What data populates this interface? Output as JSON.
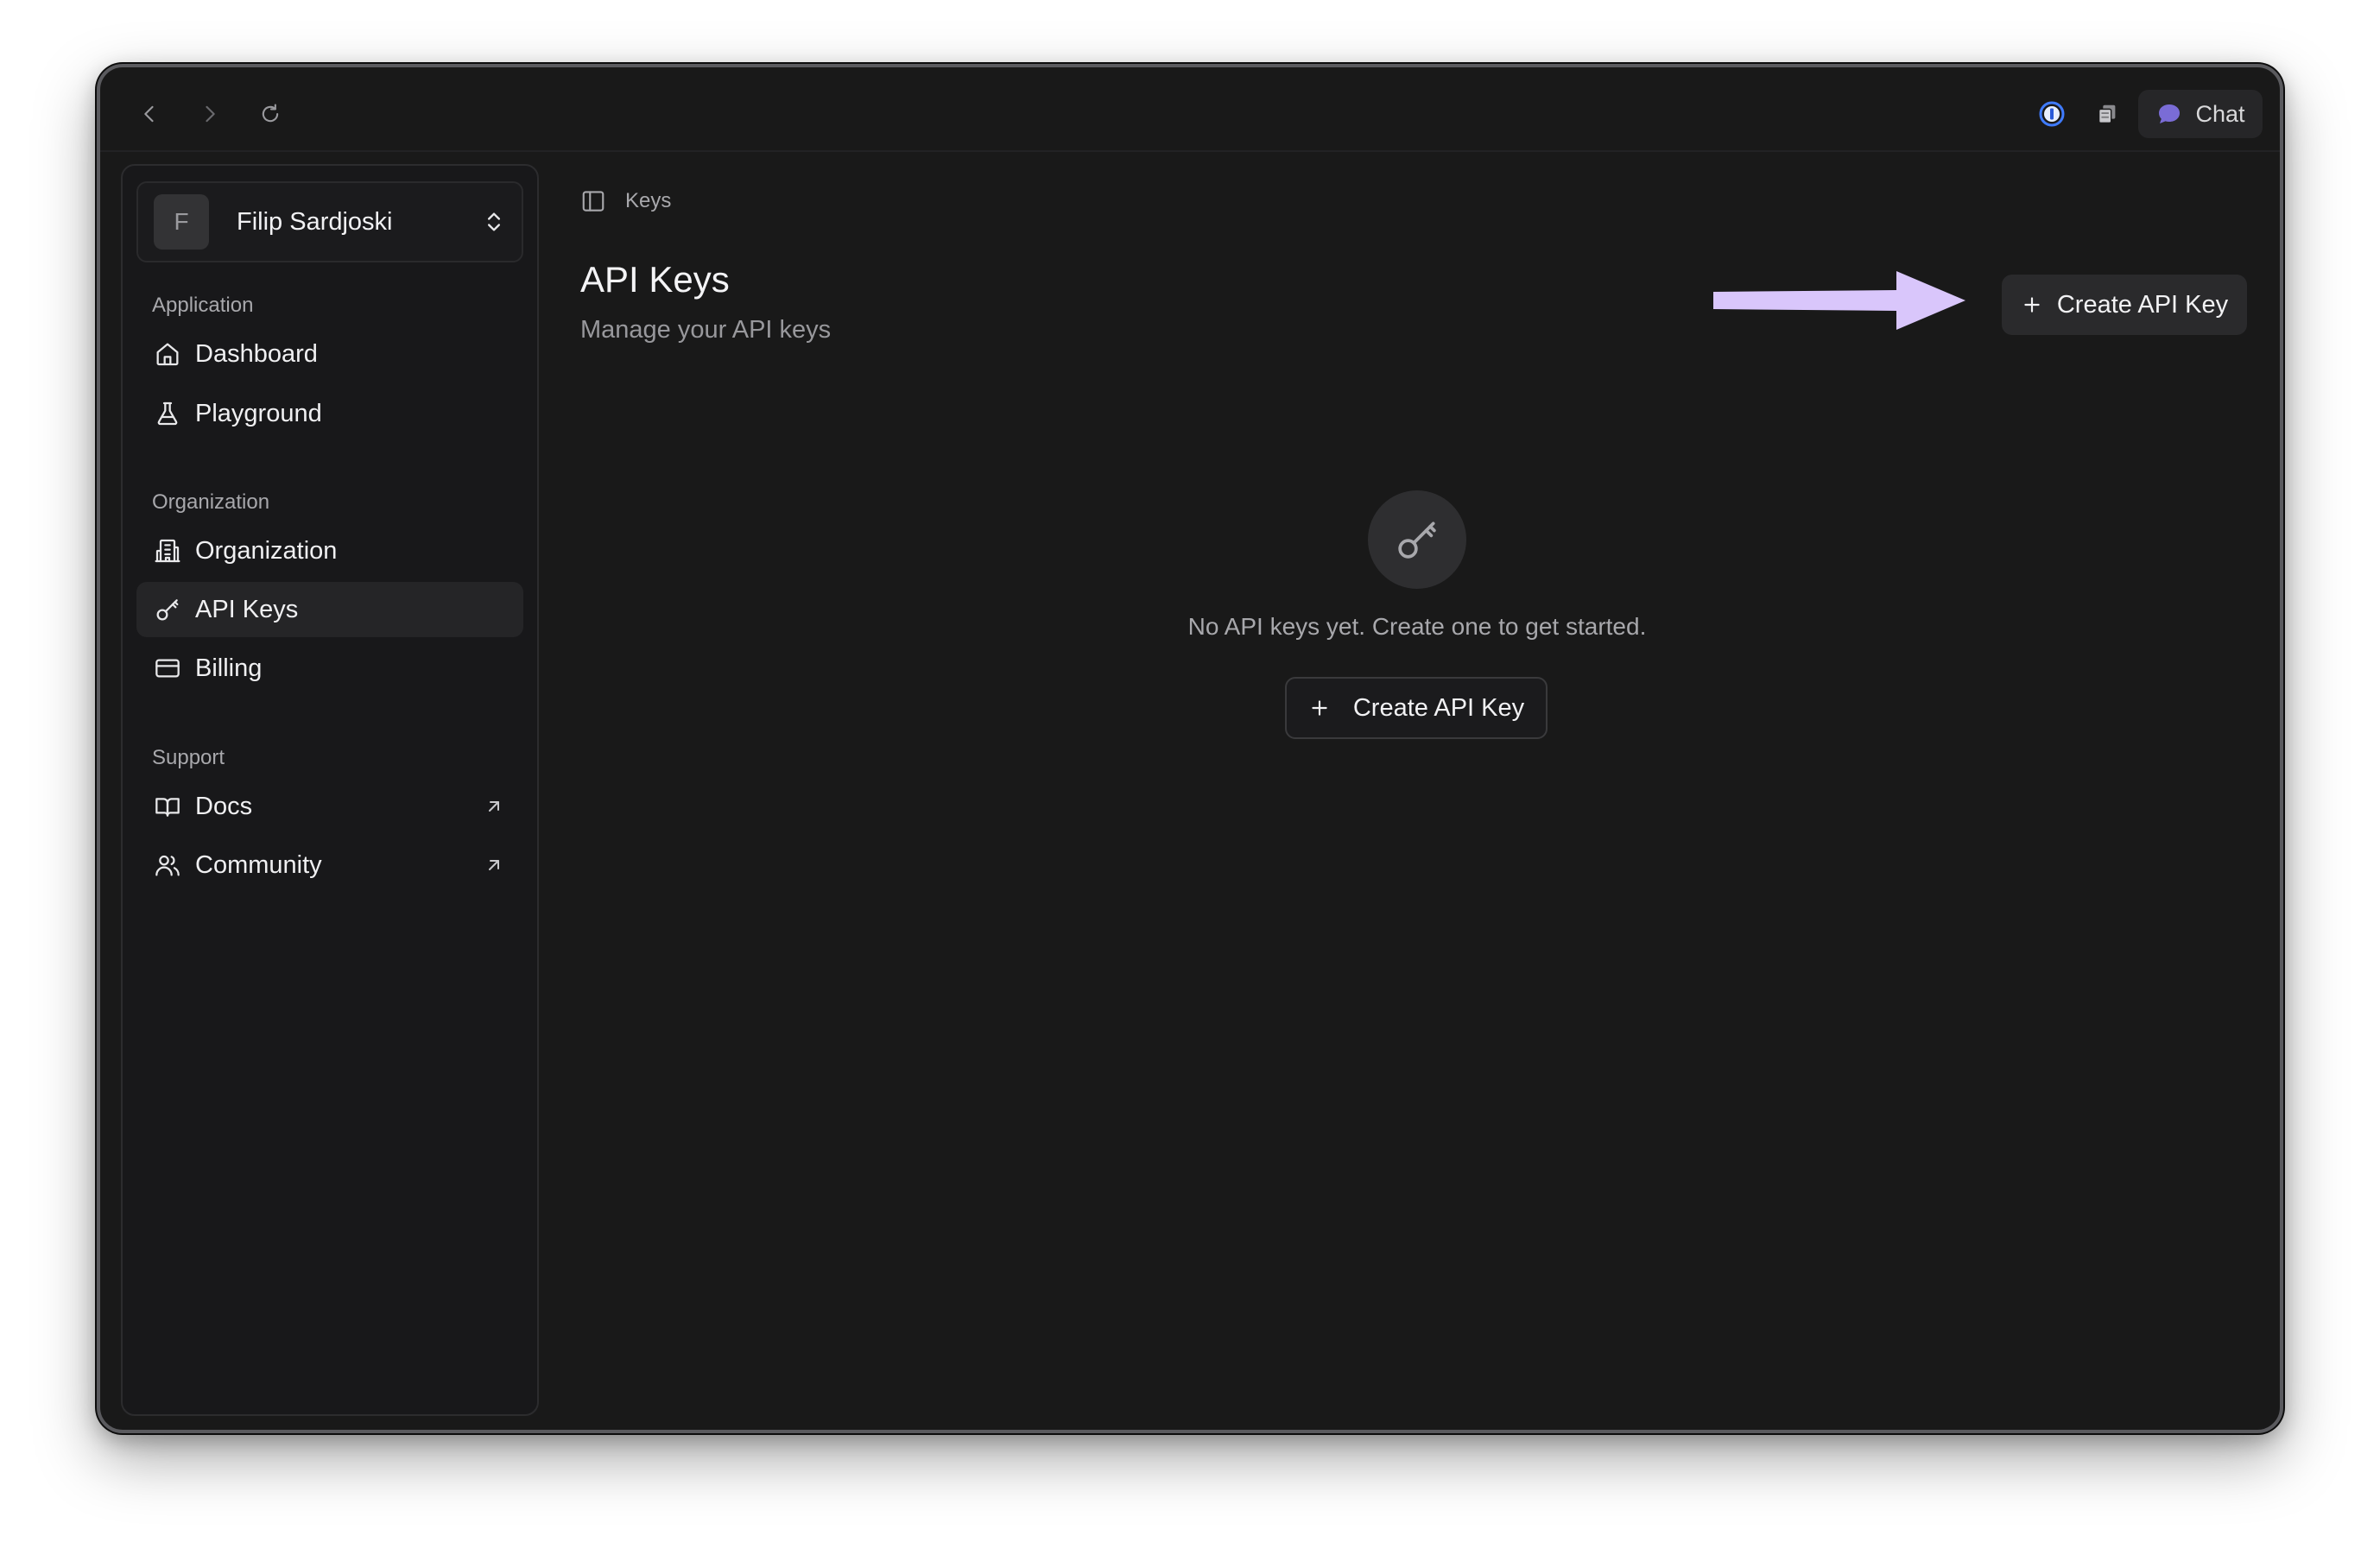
{
  "topbar": {
    "chat_label": "Chat"
  },
  "user": {
    "initial": "F",
    "name": "Filip Sardjoski"
  },
  "sidebar": {
    "sections": [
      {
        "label": "Application",
        "items": [
          {
            "label": "Dashboard",
            "icon": "home-icon"
          },
          {
            "label": "Playground",
            "icon": "flask-icon"
          }
        ]
      },
      {
        "label": "Organization",
        "items": [
          {
            "label": "Organization",
            "icon": "building-icon"
          },
          {
            "label": "API Keys",
            "icon": "key-icon",
            "active": true
          },
          {
            "label": "Billing",
            "icon": "credit-card-icon"
          }
        ]
      },
      {
        "label": "Support",
        "items": [
          {
            "label": "Docs",
            "icon": "book-icon",
            "external": true
          },
          {
            "label": "Community",
            "icon": "users-icon",
            "external": true
          }
        ]
      }
    ]
  },
  "breadcrumb": {
    "current": "Keys"
  },
  "page": {
    "title": "API Keys",
    "subtitle": "Manage your API keys",
    "create_button_label": "Create API Key"
  },
  "empty_state": {
    "message": "No API keys yet. Create one to get started.",
    "button_label": "Create API Key"
  },
  "colors": {
    "background": "#191919",
    "sidebar_active": "#252527",
    "annotation_arrow": "#d9c6fb",
    "password_manager_accent": "#3f7bff",
    "chat_icon": "#7a6cd6"
  }
}
